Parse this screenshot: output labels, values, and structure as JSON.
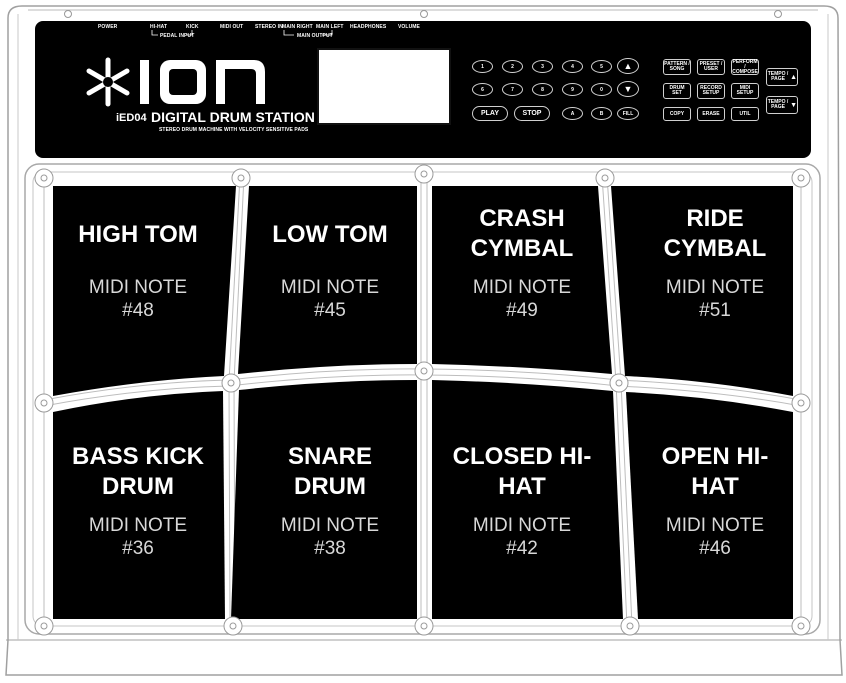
{
  "device": {
    "brand": "ION",
    "model": "iED04",
    "title": "DIGITAL DRUM STATION",
    "subtitle": "STEREO DRUM MACHINE WITH VELOCITY SENSITIVE PADS"
  },
  "jacks": {
    "power": "POWER",
    "hihat": "HI-HAT",
    "kick": "KICK",
    "pedal_input": "PEDAL INPUT",
    "midi_out": "MIDI OUT",
    "stereo_in": "STEREO IN",
    "main_right": "MAIN RIGHT",
    "main_left": "MAIN LEFT",
    "main_output": "MAIN OUTPUT",
    "headphones": "HEADPHONES",
    "volume": "VOLUME"
  },
  "controls": {
    "num_row1": [
      "1",
      "2",
      "3",
      "4",
      "5"
    ],
    "num_row2": [
      "6",
      "7",
      "8",
      "9",
      "0"
    ],
    "up": "▲",
    "down": "▼",
    "play": "PLAY",
    "stop": "STOP",
    "a": "A",
    "b": "B",
    "fill": "FILL",
    "pattern_song": "PATTERN / SONG",
    "preset_user": "PRESET / USER",
    "perform_compose": "PERFORM / COMPOSE",
    "drum_set": "DRUM SET",
    "record_setup": "RECORD SETUP",
    "midi_setup": "MIDI SETUP",
    "copy": "COPY",
    "erase": "ERASE",
    "util": "UTIL",
    "tempo_page_up": "TEMPO / PAGE",
    "tempo_page_down": "TEMPO / PAGE"
  },
  "pads": [
    {
      "name": "HIGH TOM",
      "note": "MIDI NOTE #48"
    },
    {
      "name": "LOW TOM",
      "note": "MIDI NOTE #45"
    },
    {
      "name": "CRASH CYMBAL",
      "note": "MIDI NOTE #49"
    },
    {
      "name": "RIDE CYMBAL",
      "note": "MIDI NOTE #51"
    },
    {
      "name": "BASS KICK DRUM",
      "note": "MIDI NOTE #36"
    },
    {
      "name": "SNARE DRUM",
      "note": "MIDI NOTE #38"
    },
    {
      "name": "CLOSED HI-HAT",
      "note": "MIDI NOTE #42"
    },
    {
      "name": "OPEN HI-HAT",
      "note": "MIDI NOTE #46"
    }
  ],
  "colors": {
    "body": "#ffffff",
    "panel": "#000000",
    "outline": "#9a9a9a",
    "pad_text": "#ffffff",
    "note_text": "#d8d8d8"
  }
}
